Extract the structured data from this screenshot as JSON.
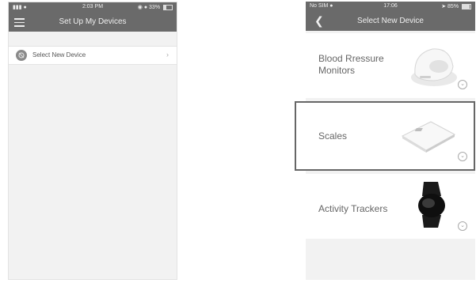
{
  "left_screen": {
    "status_bar": {
      "time": "2:03 PM",
      "battery": "33%"
    },
    "nav": {
      "title": "Set Up My Devices"
    },
    "select_row": {
      "label": "Select New Device"
    }
  },
  "right_screen": {
    "status_bar": {
      "carrier": "No SIM",
      "time": "17:06",
      "battery": "85%"
    },
    "nav": {
      "title": "Select New Device"
    },
    "devices": [
      {
        "label_line1": "Blood Rressure",
        "label_line2": "Monitors",
        "icon": "blood-pressure-monitor"
      },
      {
        "label_line1": "Scales",
        "label_line2": "",
        "icon": "scale"
      },
      {
        "label_line1": "Activity Trackers",
        "label_line2": "",
        "icon": "activity-tracker"
      }
    ]
  },
  "colors": {
    "header": "#6a6a6a",
    "background": "#f2f2f2",
    "card": "#ffffff",
    "highlight": "#666666"
  }
}
